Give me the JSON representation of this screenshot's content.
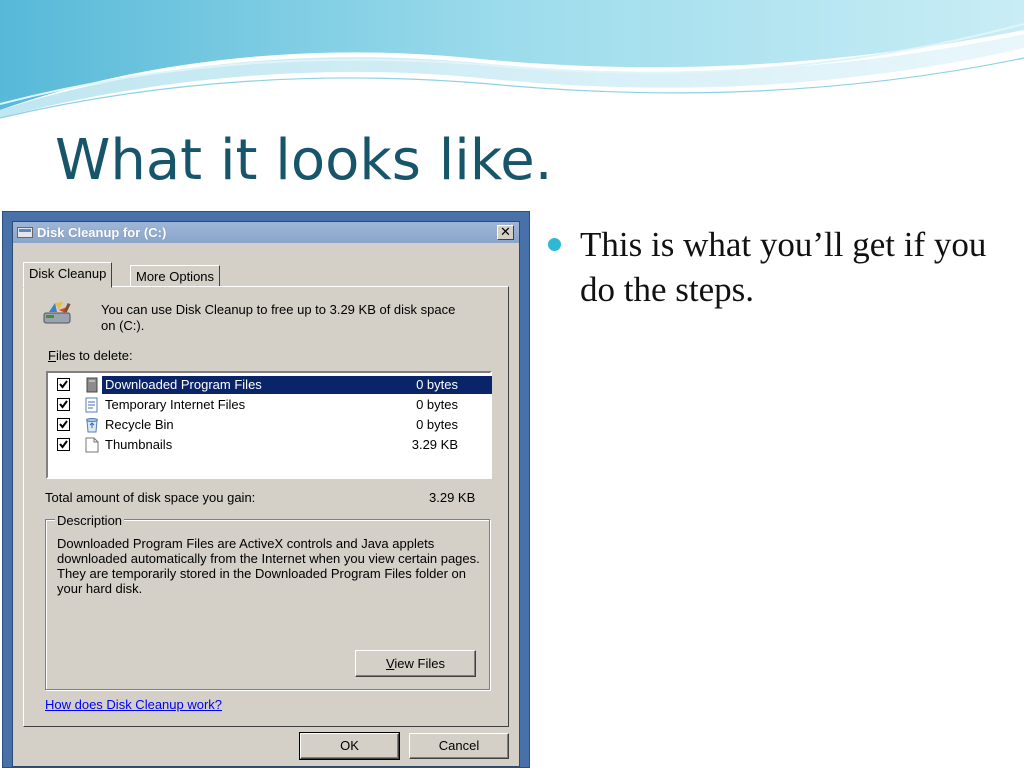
{
  "slide": {
    "title": "What it looks like.",
    "bullet": "This is what you’ll get if you do the steps."
  },
  "colors": {
    "title": "#17556b",
    "bullet_dot": "#2fb8d6",
    "window_frame": "#4771a8",
    "dialog_face": "#d4d0c8",
    "selection": "#0a246a",
    "link": "#0000ff"
  },
  "dialog": {
    "title": "Disk Cleanup for  (C:)",
    "close_glyph": "✕",
    "tabs": [
      {
        "label": "Disk Cleanup",
        "active": true
      },
      {
        "label": "More Options",
        "active": false
      }
    ],
    "info_text": "You can use Disk Cleanup to free up to 3.29 KB of disk space on  (C:).",
    "files_label_first": "F",
    "files_label_rest": "iles to delete:",
    "files": [
      {
        "name": "Downloaded Program Files",
        "size": "0 bytes",
        "checked": true,
        "selected": true,
        "icon": "folder-icon"
      },
      {
        "name": "Temporary Internet Files",
        "size": "0 bytes",
        "checked": true,
        "selected": false,
        "icon": "document-icon"
      },
      {
        "name": "Recycle Bin",
        "size": "0 bytes",
        "checked": true,
        "selected": false,
        "icon": "recycle-bin-icon"
      },
      {
        "name": "Thumbnails",
        "size": "3.29 KB",
        "checked": true,
        "selected": false,
        "icon": "blank-file-icon"
      }
    ],
    "total_label": "Total amount of disk space you gain:",
    "total_value": "3.29 KB",
    "description_legend": "Description",
    "description_text": "Downloaded Program Files are ActiveX controls and Java applets downloaded automatically from the Internet when you view certain pages. They are temporarily stored in the Downloaded Program Files folder on your hard disk.",
    "view_files_first": "V",
    "view_files_rest": "iew Files",
    "help_link": "How does Disk Cleanup work?",
    "ok_label": "OK",
    "cancel_label": "Cancel"
  }
}
